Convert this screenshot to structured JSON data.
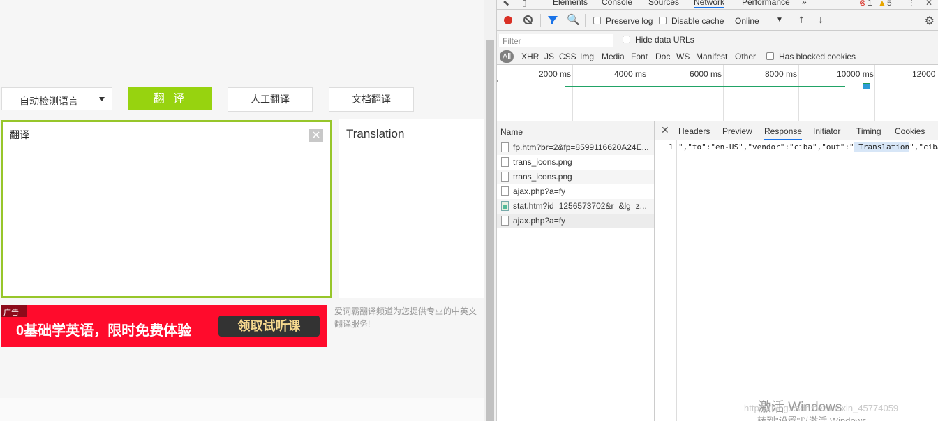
{
  "translator": {
    "lang_select": "自动检测语言",
    "translate_button": "翻 译",
    "human_translate": "人工翻译",
    "doc_translate": "文档翻译",
    "source_text": "翻译",
    "clear_symbol": "✕",
    "output_text": "Translation",
    "ad": {
      "tag": "广告",
      "text": "0基础学英语，限时免费体验",
      "button": "领取试听课"
    },
    "intro_line1": "爱词霸翻译频道为您提供专业的中英文",
    "intro_line2": "翻译服务!"
  },
  "devtools": {
    "tabs": [
      "Elements",
      "Console",
      "Sources",
      "Network",
      "Performance"
    ],
    "active_tab": "Network",
    "more_tabs": "»",
    "error_count": "1",
    "warning_count": "5",
    "menu_dots": "⋮",
    "close": "✕",
    "toolbar": {
      "preserve_log": "Preserve log",
      "disable_cache": "Disable cache",
      "throttle": "Online",
      "throttle_caret": "▼",
      "upload_arrow": "⭡",
      "download_arrow": "⭣",
      "gear": "⚙",
      "search_glyph": "🔍"
    },
    "filter_placeholder": "Filter",
    "hide_data_urls": "Hide data URLs",
    "types": [
      "All",
      "XHR",
      "JS",
      "CSS",
      "Img",
      "Media",
      "Font",
      "Doc",
      "WS",
      "Manifest",
      "Other"
    ],
    "has_blocked_cookies": "Has blocked cookies",
    "timeline_labels": [
      "2000 ms",
      "4000 ms",
      "6000 ms",
      "8000 ms",
      "10000 ms",
      "12000 ms"
    ],
    "list_header": "Name",
    "requests": [
      {
        "name": "fp.htm?br=2&fp=8599116620A24E...",
        "icon": "doc-icon"
      },
      {
        "name": "trans_icons.png",
        "icon": "doc-icon"
      },
      {
        "name": "trans_icons.png",
        "icon": "doc-icon"
      },
      {
        "name": "ajax.php?a=fy",
        "icon": "doc-icon"
      },
      {
        "name": "stat.htm?id=1256573702&r=&lg=z...",
        "icon": "image-icon"
      },
      {
        "name": "ajax.php?a=fy",
        "icon": "doc-icon"
      }
    ],
    "detail_close": "✕",
    "detail_tabs": [
      "Headers",
      "Preview",
      "Response",
      "Initiator",
      "Timing",
      "Cookies"
    ],
    "active_detail_tab": "Response",
    "response": {
      "line_no": "1",
      "before": "\",\"to\":\"en-US\",\"vendor\":\"ciba\",\"out\":\"",
      "highlight": " Translation",
      "after": "\",\"ciba"
    },
    "url_watermark": "https://blog.csdn.net/weixin_45774059",
    "activation_title": "激活 Windows",
    "activation_sub": "转到\"设置\"以激活 Windows。"
  }
}
